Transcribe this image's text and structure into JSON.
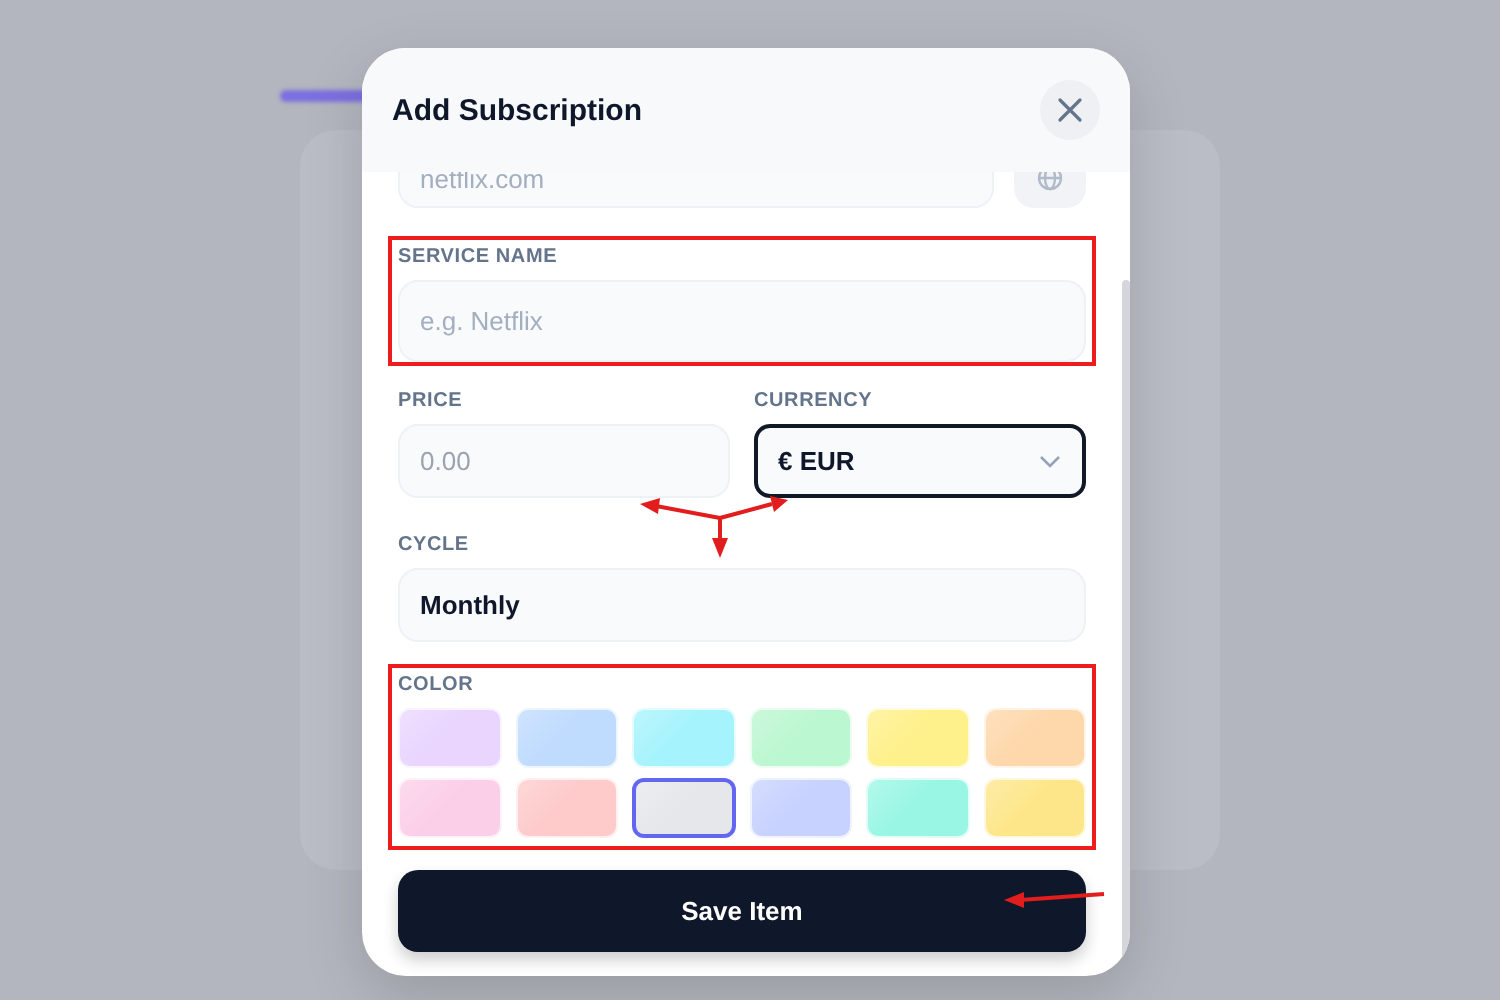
{
  "dialog": {
    "title": "Add Subscription",
    "website": {
      "placeholder": "netflix.com"
    },
    "service_name": {
      "label": "SERVICE NAME",
      "placeholder": "e.g. Netflix",
      "highlighted": true
    },
    "price": {
      "label": "PRICE",
      "placeholder": "0.00"
    },
    "currency": {
      "label": "CURRENCY",
      "value": "€ EUR",
      "focused": true
    },
    "pointer_arrows": true,
    "cycle": {
      "label": "CYCLE",
      "value": "Monthly"
    },
    "color": {
      "label": "COLOR",
      "highlighted": true,
      "swatches": [
        {
          "color": "#e9d5ff",
          "selected": false
        },
        {
          "color": "#bfdbfe",
          "selected": false
        },
        {
          "color": "#a5f3fc",
          "selected": false
        },
        {
          "color": "#bbf7d0",
          "selected": false
        },
        {
          "color": "#fef08a",
          "selected": false
        },
        {
          "color": "#fed7aa",
          "selected": false
        },
        {
          "color": "#fbcfe8",
          "selected": false
        },
        {
          "color": "#fecaca",
          "selected": false
        },
        {
          "color": "#e5e7eb",
          "selected": true
        },
        {
          "color": "#c7d2fe",
          "selected": false
        },
        {
          "color": "#99f6e4",
          "selected": false
        },
        {
          "color": "#fde68a",
          "selected": false
        }
      ]
    },
    "save_button": {
      "label": "Save Item",
      "pointer_arrow": true
    }
  }
}
